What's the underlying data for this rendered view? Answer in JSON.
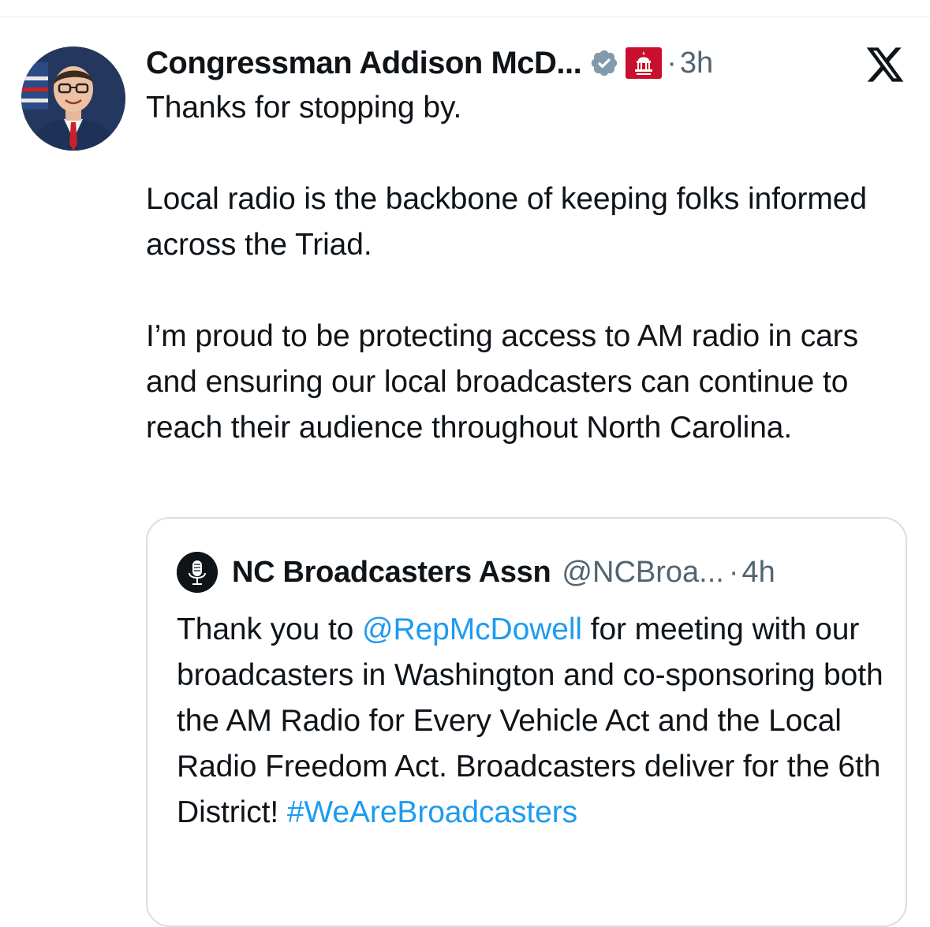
{
  "tweet": {
    "author": {
      "display_name": "Congressman Addison McD...",
      "avatar_icon": "profile-photo",
      "verified_icon": "verified-badge-icon",
      "affiliation_icon": "house-gop-capitol-icon"
    },
    "dot": "·",
    "time": "3h",
    "paragraphs": [
      "Thanks for stopping by.",
      "Local radio is the backbone of keeping folks informed across the Triad.",
      "I’m proud to be protecting access to AM radio in cars and ensuring our local broadcasters can continue to reach their audience throughout North Carolina."
    ]
  },
  "brand_icon": "x-logo-icon",
  "quote": {
    "author": {
      "display_name": "NC Broadcasters Assn",
      "handle": "@NCBroa...",
      "avatar_icon": "microphone-icon"
    },
    "dot": "·",
    "time": "4h",
    "text": {
      "part1": "Thank you to ",
      "mention": "@RepMcDowell",
      "part2": " for meeting with our broadcasters in Washington and co-sponsoring both the AM Radio for Every Vehicle Act and the Local Radio Freedom Act.  Broadcasters deliver for the 6th District! ",
      "hashtag": "#WeAreBroadcasters"
    }
  },
  "colors": {
    "link": "#1d9bf0",
    "secondary_text": "#536471",
    "verified_badge": "#829aab",
    "affiliation_badge": "#c8102e",
    "border": "#d9dfe3"
  }
}
